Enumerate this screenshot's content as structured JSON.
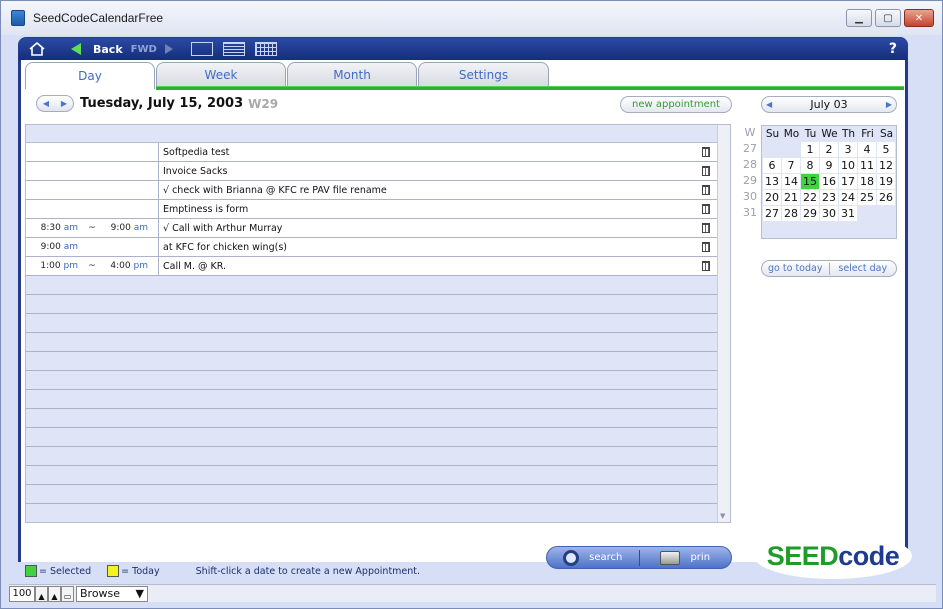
{
  "window": {
    "title": "SeedCodeCalendarFree"
  },
  "toolbar": {
    "back_label": "Back",
    "fwd_label": "FWD",
    "help_label": "?"
  },
  "tabs": [
    {
      "label": "Day",
      "active": true
    },
    {
      "label": "Week",
      "active": false
    },
    {
      "label": "Month",
      "active": false
    },
    {
      "label": "Settings",
      "active": false
    }
  ],
  "day": {
    "date_title": "Tuesday, July 15, 2003",
    "week_label": "W29",
    "new_appointment_label": "new appointment"
  },
  "appointments": [
    {
      "start": "",
      "start_ampm": "",
      "tilde": "",
      "end": "",
      "end_ampm": "",
      "text": "Softpedia test"
    },
    {
      "start": "",
      "start_ampm": "",
      "tilde": "",
      "end": "",
      "end_ampm": "",
      "text": "Invoice Sacks"
    },
    {
      "start": "",
      "start_ampm": "",
      "tilde": "",
      "end": "",
      "end_ampm": "",
      "text": "√ check with Brianna @ KFC re PAV file rename"
    },
    {
      "start": "",
      "start_ampm": "",
      "tilde": "",
      "end": "",
      "end_ampm": "",
      "text": "Emptiness is form"
    },
    {
      "start": "8:30",
      "start_ampm": "am",
      "tilde": "~",
      "end": "9:00",
      "end_ampm": "am",
      "text": "√ Call with Arthur Murray"
    },
    {
      "start": "9:00",
      "start_ampm": "am",
      "tilde": "",
      "end": "",
      "end_ampm": "",
      "text": "at KFC for chicken wing(s)"
    },
    {
      "start": "1:00",
      "start_ampm": "pm",
      "tilde": "~",
      "end": "4:00",
      "end_ampm": "pm",
      "text": "Call M. @ KR."
    }
  ],
  "mini_calendar": {
    "month_label": "July 03",
    "week_header": "W",
    "day_names": [
      "Su",
      "Mo",
      "Tu",
      "We",
      "Th",
      "Fri",
      "Sa"
    ],
    "weeks": [
      {
        "no": "27",
        "days": [
          "",
          "",
          "1",
          "2",
          "3",
          "4",
          "5"
        ]
      },
      {
        "no": "28",
        "days": [
          "6",
          "7",
          "8",
          "9",
          "10",
          "11",
          "12"
        ]
      },
      {
        "no": "29",
        "days": [
          "13",
          "14",
          "15",
          "16",
          "17",
          "18",
          "19"
        ]
      },
      {
        "no": "30",
        "days": [
          "20",
          "21",
          "22",
          "23",
          "24",
          "25",
          "26"
        ]
      },
      {
        "no": "31",
        "days": [
          "27",
          "28",
          "29",
          "30",
          "31",
          "",
          ""
        ]
      }
    ],
    "selected_day": "15",
    "go_to_today_label": "go to today",
    "select_day_label": "select day"
  },
  "actions": {
    "search_label": "search",
    "print_label": "prin"
  },
  "logo": {
    "seed": "SEED",
    "code": "code"
  },
  "legend": {
    "selected_label": "= Selected",
    "today_label": "= Today",
    "hint": "Shift-click a date to create a new Appointment."
  },
  "statusbar": {
    "zoom": "100",
    "mode": "Browse"
  },
  "colors": {
    "selected": "#3fd43f",
    "today": "#f5f222",
    "brand_green": "#1e9b2a",
    "brand_blue": "#1d3c8f",
    "frame_blue": "#243a8c"
  }
}
